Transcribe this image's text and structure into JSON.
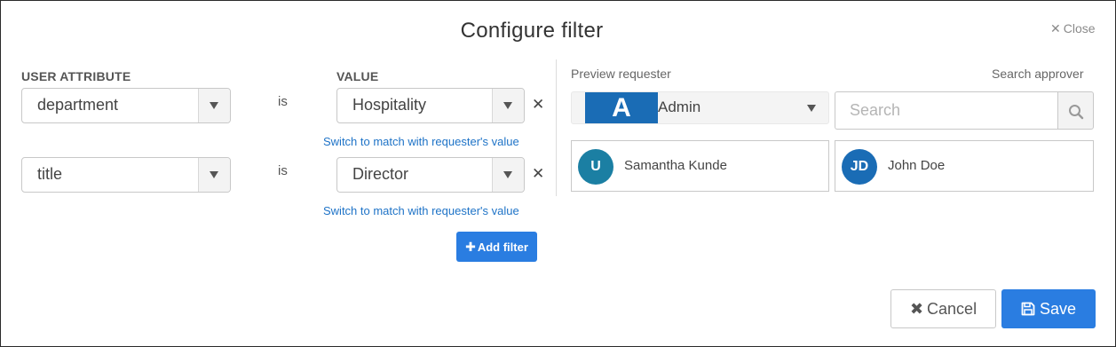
{
  "dialog": {
    "title": "Configure filter",
    "close_label": "Close"
  },
  "filters": {
    "attribute_header": "USER ATTRIBUTE",
    "value_header": "VALUE",
    "rows": [
      {
        "attribute": "department",
        "operator": "is",
        "value": "Hospitality",
        "switch_link": "Switch to match with requester's value"
      },
      {
        "attribute": "title",
        "operator": "is",
        "value": "Director",
        "switch_link": "Switch to match with requester's value"
      }
    ],
    "add_filter_label": "Add filter"
  },
  "preview": {
    "requester_label": "Preview requester",
    "requester": {
      "initial": "A",
      "name": "Admin",
      "avatar_color": "#1a6cb5"
    },
    "search_label": "Search approver",
    "search_placeholder": "Search",
    "approvers": [
      {
        "initials": "U",
        "name": "Samantha Kunde",
        "color": "#1b7fa3"
      },
      {
        "initials": "JD",
        "name": "John Doe",
        "color": "#1a6cb5"
      }
    ]
  },
  "footer": {
    "cancel_label": "Cancel",
    "save_label": "Save"
  },
  "colors": {
    "primary": "#2a7de1",
    "link": "#1e73c7"
  }
}
